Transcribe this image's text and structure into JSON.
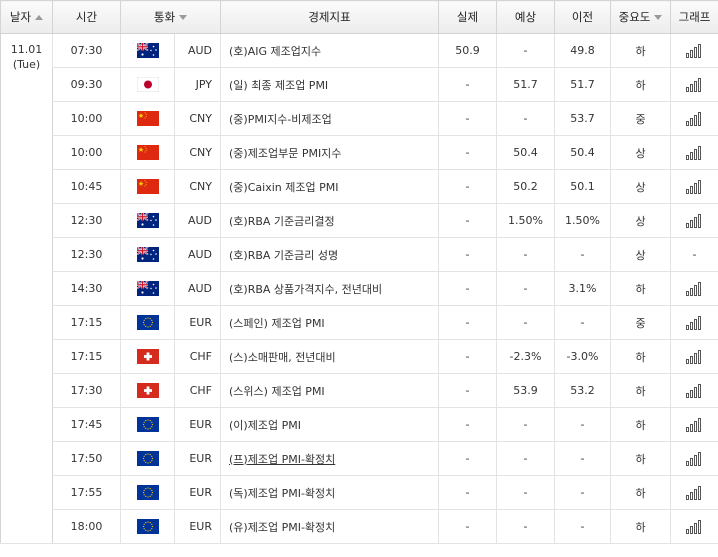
{
  "header": {
    "date": "날자",
    "time": "시간",
    "currency": "통화",
    "indicator": "경제지표",
    "actual": "실제",
    "forecast": "예상",
    "previous": "이전",
    "importance": "중요도",
    "graph": "그래프"
  },
  "date": {
    "day": "11.01",
    "weekday": "(Tue)"
  },
  "rows": [
    {
      "time": "07:30",
      "flag": "au",
      "currency": "AUD",
      "name": "(호)AIG 제조업지수",
      "actual": "50.9",
      "forecast": "-",
      "previous": "49.8",
      "importance": "하",
      "chart": true
    },
    {
      "time": "09:30",
      "flag": "jp",
      "currency": "JPY",
      "name": "(일) 최종 제조업 PMI",
      "actual": "-",
      "forecast": "51.7",
      "previous": "51.7",
      "importance": "하",
      "chart": true
    },
    {
      "time": "10:00",
      "flag": "cn",
      "currency": "CNY",
      "name": "(중)PMI지수-비제조업",
      "actual": "-",
      "forecast": "-",
      "previous": "53.7",
      "importance": "중",
      "chart": true
    },
    {
      "time": "10:00",
      "flag": "cn",
      "currency": "CNY",
      "name": "(중)제조업부문 PMI지수",
      "actual": "-",
      "forecast": "50.4",
      "previous": "50.4",
      "importance": "상",
      "chart": true
    },
    {
      "time": "10:45",
      "flag": "cn",
      "currency": "CNY",
      "name": "(중)Caixin 제조업 PMI",
      "actual": "-",
      "forecast": "50.2",
      "previous": "50.1",
      "importance": "상",
      "chart": true
    },
    {
      "time": "12:30",
      "flag": "au",
      "currency": "AUD",
      "name": "(호)RBA 기준금리결정",
      "actual": "-",
      "forecast": "1.50%",
      "previous": "1.50%",
      "importance": "상",
      "chart": true
    },
    {
      "time": "12:30",
      "flag": "au",
      "currency": "AUD",
      "name": "(호)RBA 기준금리 성명",
      "actual": "-",
      "forecast": "-",
      "previous": "-",
      "importance": "상",
      "chart": false
    },
    {
      "time": "14:30",
      "flag": "au",
      "currency": "AUD",
      "name": "(호)RBA 상품가격지수, 전년대비",
      "actual": "-",
      "forecast": "-",
      "previous": "3.1%",
      "importance": "하",
      "chart": true
    },
    {
      "time": "17:15",
      "flag": "eu",
      "currency": "EUR",
      "name": "(스페인) 제조업 PMI",
      "actual": "-",
      "forecast": "-",
      "previous": "-",
      "importance": "중",
      "chart": true
    },
    {
      "time": "17:15",
      "flag": "ch",
      "currency": "CHF",
      "name": "(스)소매판매, 전년대비",
      "actual": "-",
      "forecast": "-2.3%",
      "previous": "-3.0%",
      "importance": "하",
      "chart": true
    },
    {
      "time": "17:30",
      "flag": "ch",
      "currency": "CHF",
      "name": "(스위스) 제조업 PMI",
      "actual": "-",
      "forecast": "53.9",
      "previous": "53.2",
      "importance": "하",
      "chart": true
    },
    {
      "time": "17:45",
      "flag": "eu",
      "currency": "EUR",
      "name": "(이)제조업 PMI",
      "actual": "-",
      "forecast": "-",
      "previous": "-",
      "importance": "하",
      "chart": true
    },
    {
      "time": "17:50",
      "flag": "eu",
      "currency": "EUR",
      "name": "(프)제조업 PMI-확정치",
      "actual": "-",
      "forecast": "-",
      "previous": "-",
      "importance": "하",
      "chart": true,
      "underline": true
    },
    {
      "time": "17:55",
      "flag": "eu",
      "currency": "EUR",
      "name": "(독)제조업 PMI-확정치",
      "actual": "-",
      "forecast": "-",
      "previous": "-",
      "importance": "하",
      "chart": true
    },
    {
      "time": "18:00",
      "flag": "eu",
      "currency": "EUR",
      "name": "(유)제조업 PMI-확정치",
      "actual": "-",
      "forecast": "-",
      "previous": "-",
      "importance": "하",
      "chart": true
    }
  ],
  "colors": {
    "header_bg": "#ececec",
    "border": "#d4d4d4",
    "row_border": "#e3e3e3"
  }
}
